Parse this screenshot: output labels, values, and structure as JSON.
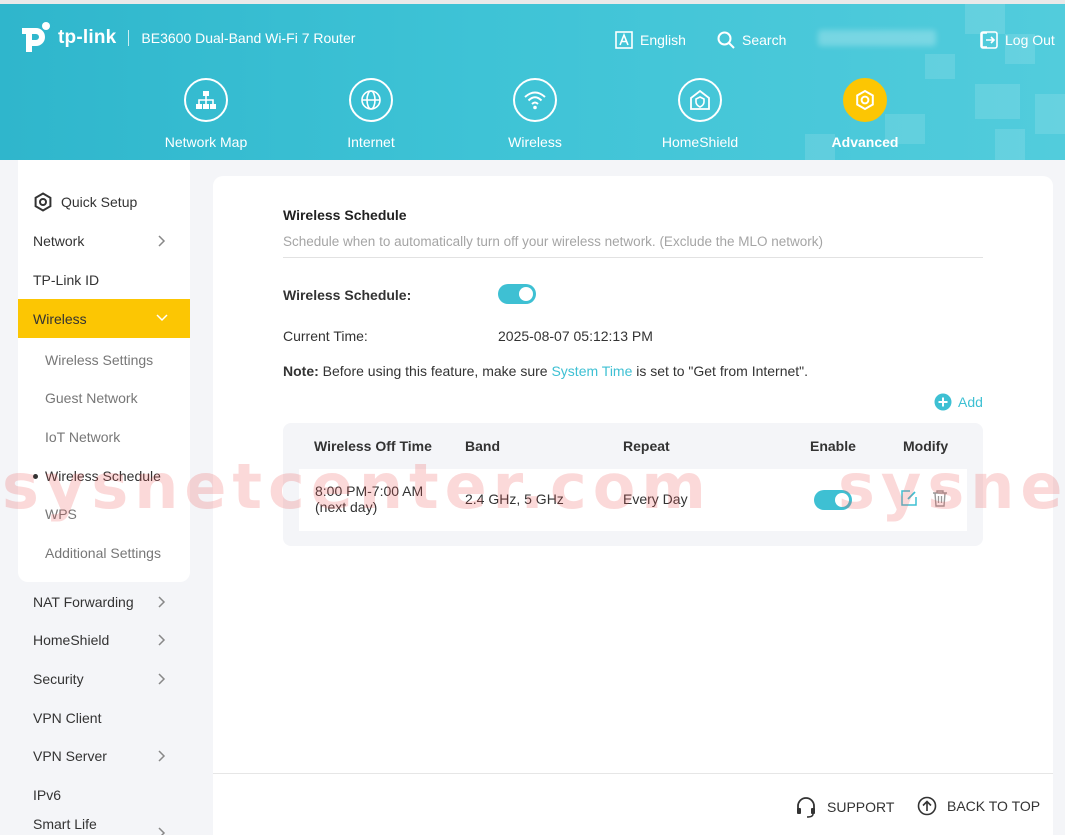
{
  "header": {
    "brand": "tp-link",
    "model": "BE3600 Dual-Band Wi-Fi 7 Router",
    "language": "English",
    "search": "Search",
    "logout": "Log Out"
  },
  "main_nav": [
    {
      "label": "Network Map",
      "icon": "network-map-icon"
    },
    {
      "label": "Internet",
      "icon": "globe-icon"
    },
    {
      "label": "Wireless",
      "icon": "wifi-icon"
    },
    {
      "label": "HomeShield",
      "icon": "shield-home-icon"
    },
    {
      "label": "Advanced",
      "icon": "gear-icon",
      "active": true
    }
  ],
  "sidebar": {
    "items": [
      {
        "label": "Quick Setup"
      },
      {
        "label": "Network"
      },
      {
        "label": "TP-Link ID"
      },
      {
        "label": "Wireless"
      },
      {
        "label": "Wireless Settings"
      },
      {
        "label": "Guest Network"
      },
      {
        "label": "IoT Network"
      },
      {
        "label": "Wireless Schedule"
      },
      {
        "label": "WPS"
      },
      {
        "label": "Additional Settings"
      },
      {
        "label": "NAT Forwarding"
      },
      {
        "label": "HomeShield"
      },
      {
        "label": "Security"
      },
      {
        "label": "VPN Client"
      },
      {
        "label": "VPN Server"
      },
      {
        "label": "IPv6"
      },
      {
        "label": "Smart Life"
      }
    ]
  },
  "content": {
    "title": "Wireless Schedule",
    "subtitle": "Schedule when to automatically turn off your wireless network. (Exclude the MLO network)",
    "schedule_label": "Wireless Schedule:",
    "schedule_enabled": true,
    "current_time_label": "Current Time:",
    "current_time": "2025-08-07 05:12:13 PM",
    "note_prefix": "Note:",
    "note_text_1": " Before using this feature, make sure ",
    "note_link": "System Time",
    "note_text_2": " is set to \"Get from Internet\".",
    "add_label": "Add"
  },
  "table": {
    "headers": [
      "Wireless Off Time",
      "Band",
      "Repeat",
      "Enable",
      "Modify"
    ],
    "rows": [
      {
        "time_line1": "8:00 PM-7:00 AM",
        "time_line2": "(next day)",
        "band": "2.4 GHz, 5 GHz",
        "repeat": "Every Day",
        "enabled": true
      }
    ]
  },
  "footer": {
    "support": "SUPPORT",
    "back_to_top": "BACK TO TOP"
  },
  "watermark": {
    "text1": "sysnetcenter.com",
    "text2": "sysne"
  },
  "colors": {
    "header": "#3ec3d6",
    "accent": "#3ec0d3",
    "active": "#fcc603"
  }
}
